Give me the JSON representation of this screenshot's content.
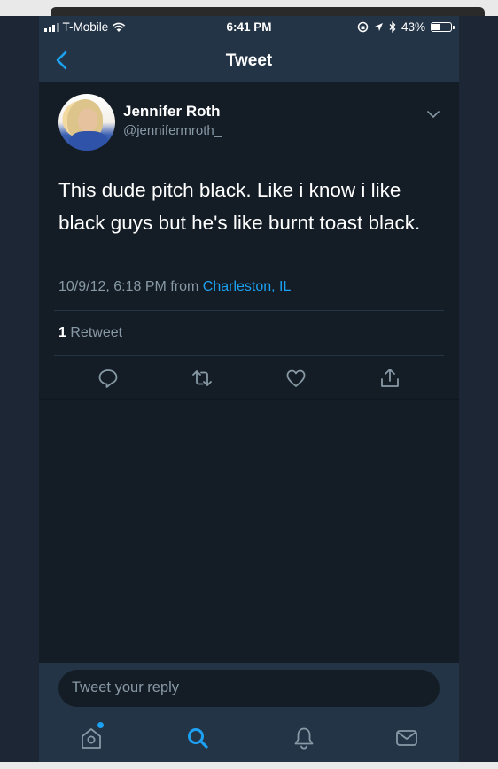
{
  "status_bar": {
    "carrier": "T-Mobile",
    "time": "6:41 PM",
    "battery_percent": "43%",
    "battery_level": 0.43
  },
  "nav": {
    "title": "Tweet",
    "back_icon": "chevron-left-icon"
  },
  "tweet": {
    "author_name": "Jennifer Roth",
    "author_handle": "@jennifermroth_",
    "text": "This dude pitch black. Like i know i like black guys but he's like burnt toast black.",
    "timestamp": "10/9/12, 6:18 PM from",
    "location": "Charleston, IL",
    "retweet_count": "1",
    "retweet_label": "Retweet",
    "actions": [
      "reply-icon",
      "retweet-icon",
      "like-icon",
      "share-icon"
    ]
  },
  "reply": {
    "placeholder": "Tweet your reply"
  },
  "tab_bar": {
    "items": [
      "home-icon",
      "search-icon",
      "notifications-icon",
      "messages-icon"
    ],
    "active": "search-icon"
  },
  "colors": {
    "background": "#141d26",
    "bar": "#243447",
    "accent": "#1da1f2",
    "muted_text": "#8899a6"
  }
}
